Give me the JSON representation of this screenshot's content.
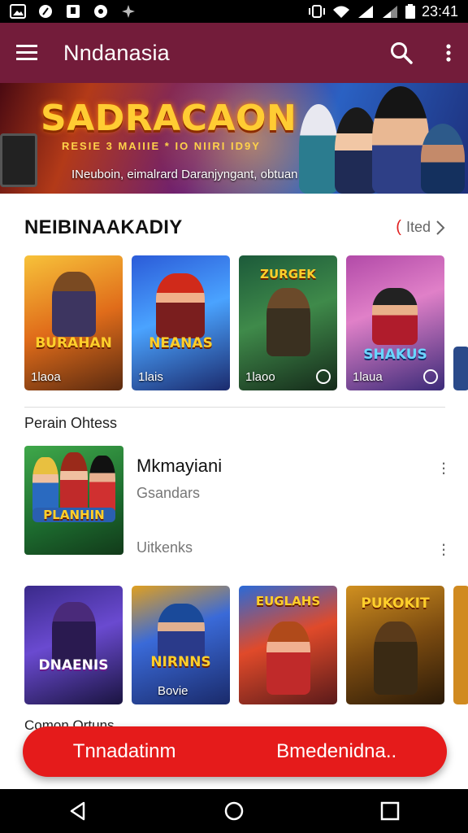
{
  "status_bar": {
    "time": "23:41"
  },
  "app_bar": {
    "title": "Nndanasia"
  },
  "banner": {
    "title": "SADRACAON",
    "subtitle": "RESIE 3 MAIIIE * IO NIIRI ID9Y",
    "caption": "INeuboin, eimalrard Daranjyngant, obtuan"
  },
  "section1": {
    "title": "NEIBINAAKADIY",
    "see_all": "Ited",
    "cards": [
      {
        "title": "BURAHAN",
        "caption": "1laoa"
      },
      {
        "title": "NEANAS",
        "caption": "1lais"
      },
      {
        "title": "ZURGEK",
        "caption": "1laoo"
      },
      {
        "title": "SHAKUS",
        "caption": "1laua"
      }
    ]
  },
  "sub_heading": "Perain Ohtess",
  "feature": {
    "thumb_title": "PLANHIN",
    "name": "Mkmayiani",
    "meta": "Gsandars",
    "meta2": "Uitkenks"
  },
  "section2": {
    "cards": [
      {
        "title": "DNAENIS",
        "caption": ""
      },
      {
        "title": "NIRNNS",
        "caption": "Bovie"
      },
      {
        "title": "EUGLAHS",
        "caption": ""
      },
      {
        "title": "PUKOKIT",
        "caption": ""
      }
    ],
    "peek": "Comon Ortuns"
  },
  "cta": {
    "left": "Tnnadatinm",
    "right": "Bmedenidna.."
  },
  "colors": {
    "app_bar": "#731c3a",
    "cta": "#e51b1b"
  }
}
